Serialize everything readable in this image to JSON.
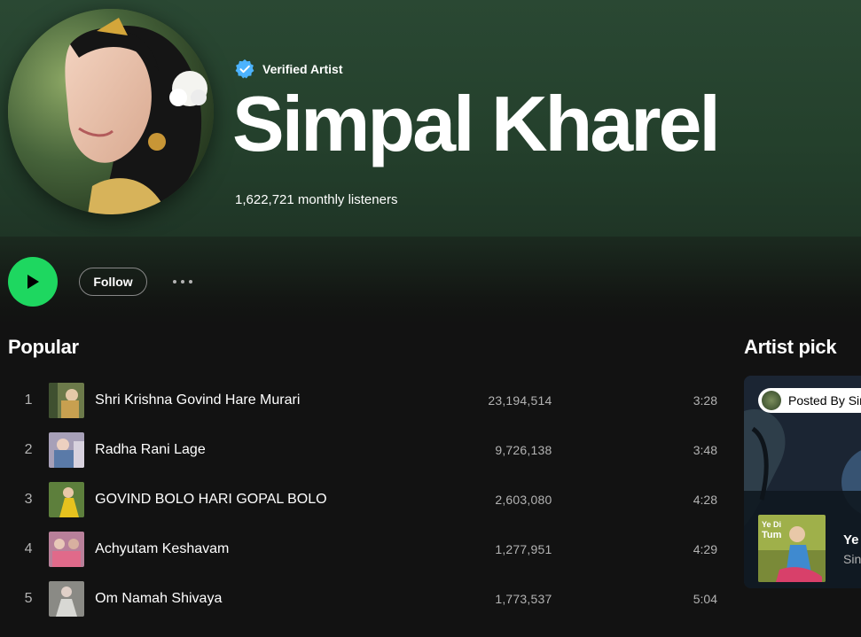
{
  "artist": {
    "verified_label": "Verified Artist",
    "name": "Simpal Kharel",
    "monthly_listeners": "1,622,721 monthly listeners"
  },
  "actions": {
    "follow_label": "Follow"
  },
  "popular": {
    "title": "Popular",
    "tracks": [
      {
        "num": "1",
        "title": "Shri Krishna Govind Hare Murari",
        "plays": "23,194,514",
        "duration": "3:28",
        "thumb_color": "#6c7a4a"
      },
      {
        "num": "2",
        "title": "Radha Rani Lage",
        "plays": "9,726,138",
        "duration": "3:48",
        "thumb_color": "#9a8aa8"
      },
      {
        "num": "3",
        "title": "GOVIND BOLO HARI GOPAL BOLO",
        "plays": "2,603,080",
        "duration": "4:28",
        "thumb_color": "#c9a92a"
      },
      {
        "num": "4",
        "title": "Achyutam Keshavam",
        "plays": "1,277,951",
        "duration": "4:29",
        "thumb_color": "#b87a9a"
      },
      {
        "num": "5",
        "title": "Om Namah Shivaya",
        "plays": "1,773,537",
        "duration": "5:04",
        "thumb_color": "#7d7d78"
      }
    ]
  },
  "artist_pick": {
    "title": "Artist pick",
    "posted_by": "Posted By Sim",
    "song": "Ye",
    "subtitle": "Sin",
    "thumb_text": "Ye Di Tum"
  },
  "colors": {
    "accent": "#1ed760",
    "header_bg": "#2a4833",
    "verified_blue": "#4cb3ff"
  }
}
